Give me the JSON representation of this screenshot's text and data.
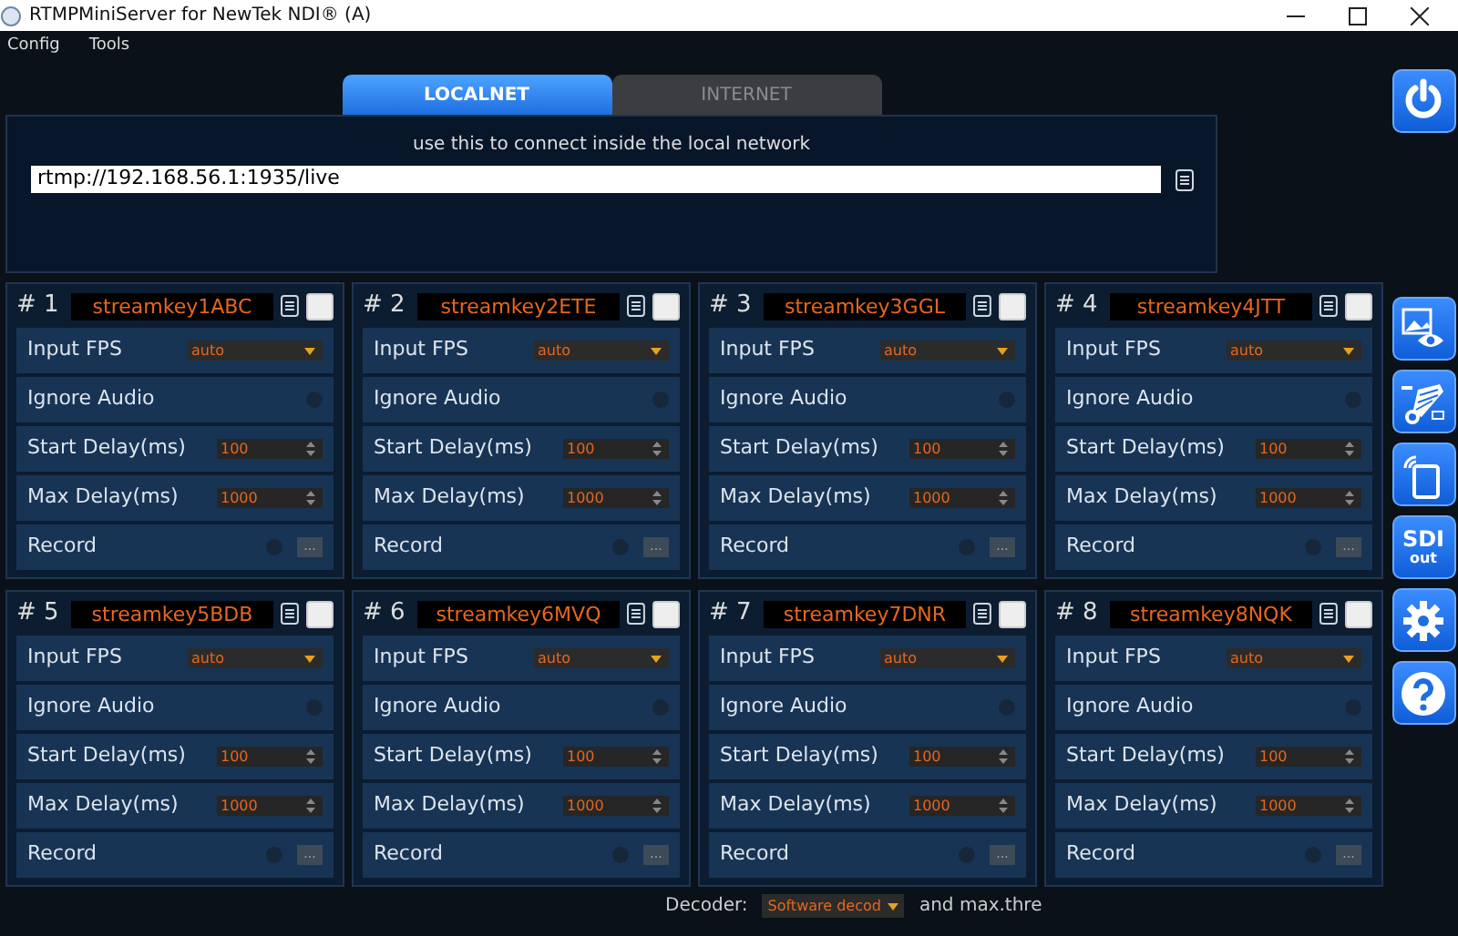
{
  "window": {
    "title": "RTMPMiniServer for NewTek NDI® (A)"
  },
  "menu": [
    "Config",
    "Tools"
  ],
  "tabs": [
    {
      "label": "LOCALNET",
      "selected": true
    },
    {
      "label": "INTERNET",
      "selected": false
    }
  ],
  "connect_panel": {
    "hint": "use this to connect inside the local network",
    "url": "rtmp://192.168.56.1:1935/live"
  },
  "streams": [
    {
      "number": "# 1",
      "key": "streamkey1ABC",
      "checked": false,
      "rows": [
        {
          "kind": "select",
          "label": "Input FPS",
          "value": "auto"
        },
        {
          "kind": "toggle",
          "label": "Ignore Audio",
          "on": false
        },
        {
          "kind": "spin",
          "label": "Start Delay(ms)",
          "value": "100"
        },
        {
          "kind": "spin",
          "label": "Max Delay(ms)",
          "value": "1000"
        },
        {
          "kind": "record",
          "label": "Record",
          "on": false,
          "button": "..."
        }
      ]
    },
    {
      "number": "# 2",
      "key": "streamkey2ETE",
      "checked": false,
      "rows": [
        {
          "kind": "select",
          "label": "Input FPS",
          "value": "auto"
        },
        {
          "kind": "toggle",
          "label": "Ignore Audio",
          "on": false
        },
        {
          "kind": "spin",
          "label": "Start Delay(ms)",
          "value": "100"
        },
        {
          "kind": "spin",
          "label": "Max Delay(ms)",
          "value": "1000"
        },
        {
          "kind": "record",
          "label": "Record",
          "on": false,
          "button": "..."
        }
      ]
    },
    {
      "number": "# 3",
      "key": "streamkey3GGL",
      "checked": false,
      "rows": [
        {
          "kind": "select",
          "label": "Input FPS",
          "value": "auto"
        },
        {
          "kind": "toggle",
          "label": "Ignore Audio",
          "on": false
        },
        {
          "kind": "spin",
          "label": "Start Delay(ms)",
          "value": "100"
        },
        {
          "kind": "spin",
          "label": "Max Delay(ms)",
          "value": "1000"
        },
        {
          "kind": "record",
          "label": "Record",
          "on": false,
          "button": "..."
        }
      ]
    },
    {
      "number": "# 4",
      "key": "streamkey4JTT",
      "checked": false,
      "rows": [
        {
          "kind": "select",
          "label": "Input FPS",
          "value": "auto"
        },
        {
          "kind": "toggle",
          "label": "Ignore Audio",
          "on": false
        },
        {
          "kind": "spin",
          "label": "Start Delay(ms)",
          "value": "100"
        },
        {
          "kind": "spin",
          "label": "Max Delay(ms)",
          "value": "1000"
        },
        {
          "kind": "record",
          "label": "Record",
          "on": false,
          "button": "..."
        }
      ]
    },
    {
      "number": "# 5",
      "key": "streamkey5BDB",
      "checked": false,
      "rows": [
        {
          "kind": "select",
          "label": "Input FPS",
          "value": "auto"
        },
        {
          "kind": "toggle",
          "label": "Ignore Audio",
          "on": false
        },
        {
          "kind": "spin",
          "label": "Start Delay(ms)",
          "value": "100"
        },
        {
          "kind": "spin",
          "label": "Max Delay(ms)",
          "value": "1000"
        },
        {
          "kind": "record",
          "label": "Record",
          "on": false,
          "button": "..."
        }
      ]
    },
    {
      "number": "# 6",
      "key": "streamkey6MVQ",
      "checked": false,
      "rows": [
        {
          "kind": "select",
          "label": "Input FPS",
          "value": "auto"
        },
        {
          "kind": "toggle",
          "label": "Ignore Audio",
          "on": false
        },
        {
          "kind": "spin",
          "label": "Start Delay(ms)",
          "value": "100"
        },
        {
          "kind": "spin",
          "label": "Max Delay(ms)",
          "value": "1000"
        },
        {
          "kind": "record",
          "label": "Record",
          "on": false,
          "button": "..."
        }
      ]
    },
    {
      "number": "# 7",
      "key": "streamkey7DNR",
      "checked": false,
      "rows": [
        {
          "kind": "select",
          "label": "Input FPS",
          "value": "auto"
        },
        {
          "kind": "toggle",
          "label": "Ignore Audio",
          "on": false
        },
        {
          "kind": "spin",
          "label": "Start Delay(ms)",
          "value": "100"
        },
        {
          "kind": "spin",
          "label": "Max Delay(ms)",
          "value": "1000"
        },
        {
          "kind": "record",
          "label": "Record",
          "on": false,
          "button": "..."
        }
      ]
    },
    {
      "number": "# 8",
      "key": "streamkey8NQK",
      "checked": false,
      "rows": [
        {
          "kind": "select",
          "label": "Input FPS",
          "value": "auto"
        },
        {
          "kind": "toggle",
          "label": "Ignore Audio",
          "on": false
        },
        {
          "kind": "spin",
          "label": "Start Delay(ms)",
          "value": "100"
        },
        {
          "kind": "spin",
          "label": "Max Delay(ms)",
          "value": "1000"
        },
        {
          "kind": "record",
          "label": "Record",
          "on": false,
          "button": "..."
        }
      ]
    }
  ],
  "side_buttons": [
    {
      "kind": "power"
    },
    {
      "kind": "preview"
    },
    {
      "kind": "ndi"
    },
    {
      "kind": "mobile"
    },
    {
      "kind": "sdi",
      "label": "SDI",
      "sublabel": "out"
    },
    {
      "kind": "settings"
    },
    {
      "kind": "help"
    }
  ],
  "footer": {
    "decoder_label": "Decoder:",
    "decoder_value": "Software decod",
    "trailing": "and max.thre"
  }
}
